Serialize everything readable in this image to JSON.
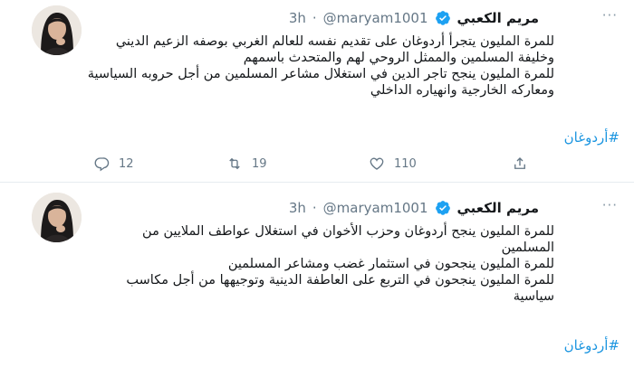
{
  "tweets": [
    {
      "display_name": "مريم الكعبي",
      "username": "@maryam1001",
      "separator": "·",
      "time": "3h",
      "more_label": "···",
      "lines": [
        "للمرة المليون يتجرأ أردوغان على تقديم نفسه للعالم الغربي بوصفه الزعيم الديني",
        "وخليفة المسلمين والممثل الروحي لهم والمتحدث باسمهم",
        "للمرة المليون ينجح تاجر الدين في استغلال مشاعر المسلمين من أجل حروبه السياسية",
        "ومعاركه الخارجية وانهياره الداخلي"
      ],
      "hashtag": "#أردوغان",
      "replies": "12",
      "retweets": "19",
      "likes": "110"
    },
    {
      "display_name": "مريم الكعبي",
      "username": "@maryam1001",
      "separator": "·",
      "time": "3h",
      "more_label": "···",
      "lines": [
        "للمرة المليون ينجح أردوغان وحزب الأخوان في استغلال عواطف الملايين من",
        "المسلمين",
        "للمرة المليون ينجحون في استثمار غضب ومشاعر المسلمين",
        "للمرة المليون ينجحون في التربع على العاطفة الدينية وتوجيهها من أجل مكاسب",
        "سياسية"
      ],
      "hashtag": "#أردوغان"
    }
  ],
  "icons": {
    "verified": "verified-badge-icon",
    "reply": "reply-icon",
    "retweet": "retweet-icon",
    "like": "heart-icon",
    "share": "share-icon"
  },
  "colors": {
    "link": "#1b95e0",
    "verified": "#1da1f2",
    "muted": "#657786",
    "divider": "#e6ecf0"
  }
}
